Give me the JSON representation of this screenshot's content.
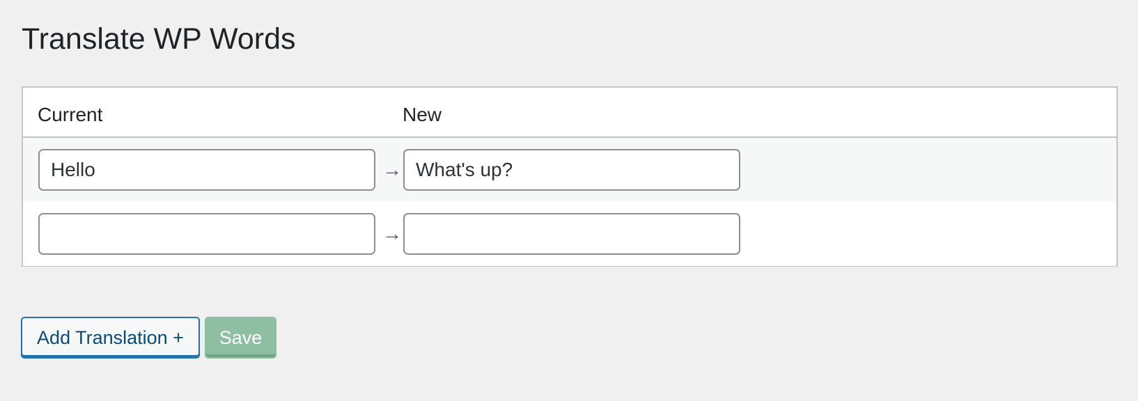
{
  "page": {
    "title": "Translate WP Words"
  },
  "table": {
    "headers": {
      "current": "Current",
      "new": "New"
    },
    "rows": [
      {
        "current": "Hello",
        "new": "What's up?"
      },
      {
        "current": "",
        "new": ""
      }
    ],
    "arrow": "→"
  },
  "actions": {
    "add_label": "Add Translation +",
    "save_label": "Save"
  },
  "colors": {
    "primary": "#2271b1",
    "save_disabled": "#8fbfa2",
    "background": "#f0f0f1"
  }
}
